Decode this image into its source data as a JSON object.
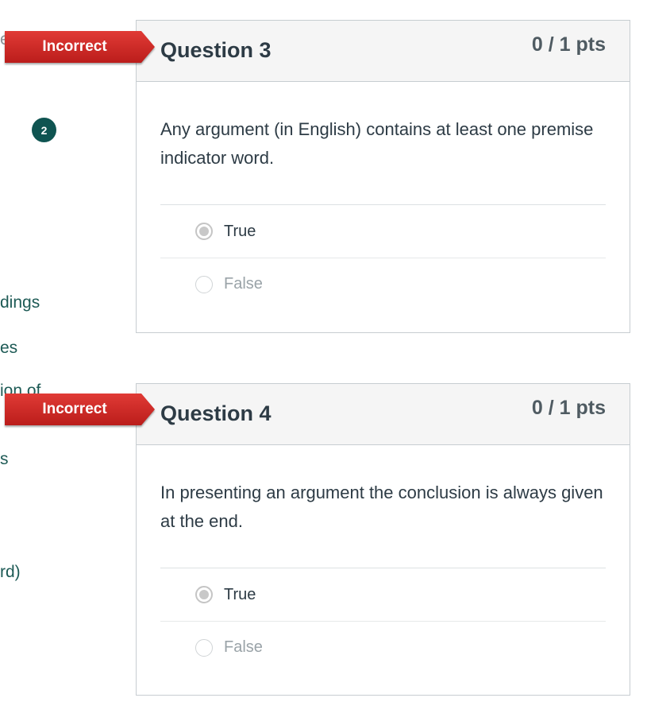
{
  "sidebar": {
    "fragments": [
      "es",
      "dings",
      "es",
      "ion of",
      "s",
      "rd)"
    ],
    "badge_count": "2"
  },
  "questions": [
    {
      "status": "Incorrect",
      "title": "Question 3",
      "points": "0 / 1 pts",
      "text": "Any argument (in English) contains at least one premise indicator word.",
      "answers": [
        {
          "label": "True",
          "selected": true
        },
        {
          "label": "False",
          "selected": false
        }
      ]
    },
    {
      "status": "Incorrect",
      "title": "Question 4",
      "points": "0 / 1 pts",
      "text": "In presenting an argument the conclusion is always given at the end.",
      "answers": [
        {
          "label": "True",
          "selected": true
        },
        {
          "label": "False",
          "selected": false
        }
      ]
    }
  ],
  "colors": {
    "ribbon": "#cc2a26",
    "sidebar_link": "#1d5a55",
    "badge": "#0f5451",
    "header_bg": "#f5f5f5"
  }
}
